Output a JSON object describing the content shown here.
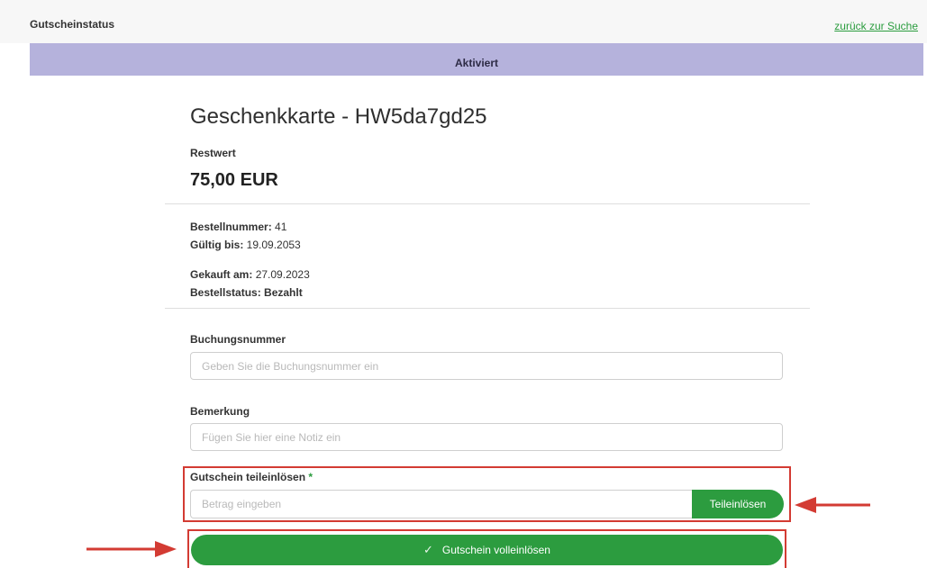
{
  "header": {
    "title": "Gutscheinstatus",
    "back_link": "zurück zur Suche"
  },
  "status": {
    "label": "Aktiviert",
    "color": "#b5b2dc"
  },
  "voucher": {
    "title": "Geschenkkarte - HW5da7gd25",
    "remaining_label": "Restwert",
    "remaining_amount": "75,00 EUR"
  },
  "details": {
    "order_number_label": "Bestellnummer:",
    "order_number": "41",
    "valid_until_label": "Gültig bis:",
    "valid_until": "19.09.2053",
    "purchased_label": "Gekauft am:",
    "purchased": "27.09.2023",
    "order_status_label": "Bestellstatus:",
    "order_status": "Bezahlt"
  },
  "form": {
    "booking_label": "Buchungsnummer",
    "booking_placeholder": "Geben Sie die Buchungsnummer ein",
    "note_label": "Bemerkung",
    "note_placeholder": "Fügen Sie hier eine Notiz ein",
    "partial_label": "Gutschein teileinlösen",
    "partial_required_mark": "*",
    "partial_placeholder": "Betrag eingeben",
    "partial_button": "Teileinlösen",
    "full_button": "Gutschein volleinlösen",
    "full_button_icon": "check-icon"
  },
  "colors": {
    "accent": "#2c9c3f",
    "highlight": "#d33b33"
  }
}
